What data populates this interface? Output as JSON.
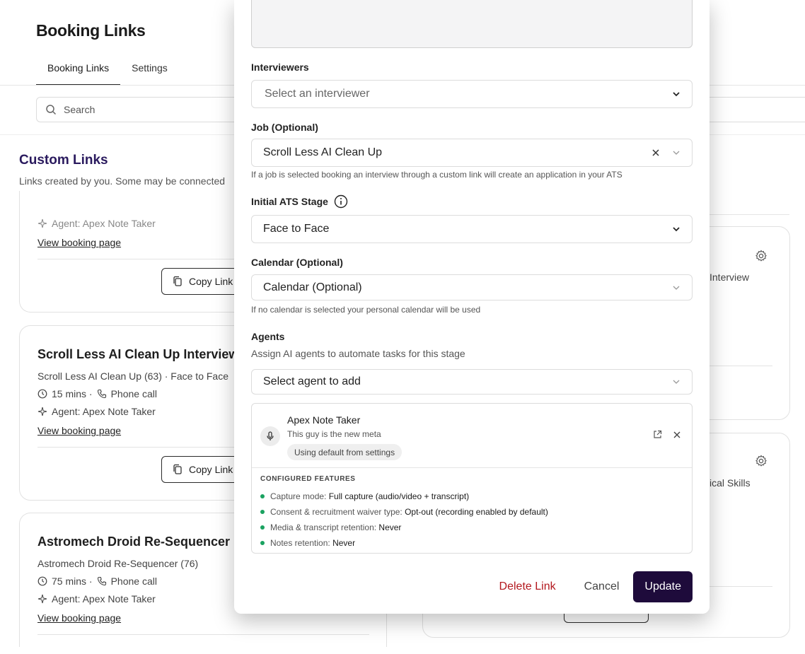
{
  "page": {
    "title": "Booking Links",
    "tabs": [
      {
        "label": "Booking Links",
        "active": true
      },
      {
        "label": "Settings",
        "active": false
      }
    ],
    "search_placeholder": "Search",
    "custom_links_title": "Custom Links",
    "custom_links_sub": "Links created by you. Some may be connected",
    "cards": [
      {
        "partial_agent": "Agent: Apex Note Taker",
        "view_link": "View booking page",
        "copy_label": "Copy Link"
      },
      {
        "title": "Scroll Less AI Clean Up Interview",
        "meta": "Scroll Less AI Clean Up (63) · Face to Face",
        "duration": "15 mins · ",
        "call": "Phone call",
        "agent": "Agent: Apex Note Taker",
        "view_link": "View booking page",
        "copy_label": "Copy Link"
      },
      {
        "title": "Astromech Droid Re-Sequencer",
        "meta": "Astromech Droid Re-Sequencer (76)",
        "duration": "75 mins · ",
        "call": "Phone call",
        "agent": "Agent: Apex Note Taker",
        "view_link": "View booking page"
      }
    ],
    "right_texts": [
      "Interview",
      "ical Skills"
    ]
  },
  "modal": {
    "interviewers_label": "Interviewers",
    "interviewers_placeholder": "Select an interviewer",
    "job_label": "Job (Optional)",
    "job_value": "Scroll Less AI Clean Up",
    "job_help": "If a job is selected booking an interview through a custom link will create an application in your ATS",
    "stage_label": "Initial ATS Stage",
    "stage_value": "Face to Face",
    "calendar_label": "Calendar (Optional)",
    "calendar_value": "Calendar (Optional)",
    "calendar_help": "If no calendar is selected your personal calendar will be used",
    "agents_label": "Agents",
    "agents_desc": "Assign AI agents to automate tasks for this stage",
    "agent_select_placeholder": "Select agent to add",
    "agent": {
      "name": "Apex Note Taker",
      "desc": "This guy is the new meta",
      "pill": "Using default from settings",
      "features_title": "CONFIGURED FEATURES",
      "features": [
        {
          "label": "Capture mode: ",
          "value": "Full capture (audio/video + transcript)"
        },
        {
          "label": "Consent & recruitment waiver type: ",
          "value": "Opt-out (recording enabled by default)"
        },
        {
          "label": "Media & transcript retention: ",
          "value": "Never"
        },
        {
          "label": "Notes retention: ",
          "value": "Never"
        }
      ]
    },
    "buttons": {
      "delete": "Delete Link",
      "cancel": "Cancel",
      "update": "Update"
    }
  },
  "colors": {
    "accent_dark": "#1e0b3b",
    "danger": "#b3181e",
    "feature_dot": "#1aa260"
  }
}
